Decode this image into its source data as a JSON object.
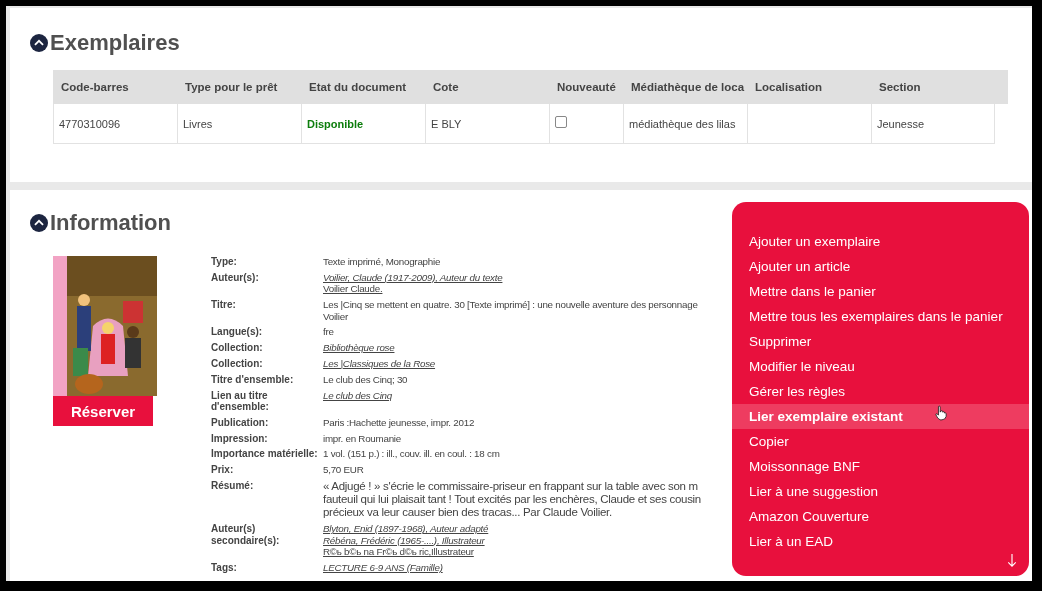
{
  "exemplaires": {
    "title": "Exemplaires",
    "expanded": true,
    "columns": [
      "Code-barres",
      "Type pour le prêt",
      "Etat du document",
      "Cote",
      "Nouveauté",
      "Médiathèque de loca",
      "Localisation",
      "Section"
    ],
    "rows": [
      {
        "code_barres": "4770310096",
        "type": "Livres",
        "etat": "Disponible",
        "cote": "E BLY",
        "nouveaute": false,
        "mediatheque": "médiathèque des lilas",
        "localisation": "",
        "section": "Jeunesse"
      }
    ]
  },
  "information": {
    "title": "Information",
    "expanded": true,
    "reserve_button": "Réserver",
    "fields": [
      {
        "label": "Type:",
        "values": [
          {
            "text": "Texte imprimé, Monographie",
            "kind": "plain"
          }
        ]
      },
      {
        "label": "Auteur(s):",
        "values": [
          {
            "text": "Voilier, Claude (1917-2009), Auteur du texte",
            "kind": "link"
          },
          {
            "text": "Voilier Claude.",
            "kind": "underlined"
          }
        ]
      },
      {
        "label": "Titre:",
        "values": [
          {
            "text": "Les |Cinq se mettent en quatre. 30 [Texte imprimé] : une nouvelle aventure des personnage",
            "kind": "plain"
          },
          {
            "text": "Voilier",
            "kind": "plain"
          }
        ]
      },
      {
        "label": "Langue(s):",
        "values": [
          {
            "text": "fre",
            "kind": "plain"
          }
        ]
      },
      {
        "label": "Collection:",
        "values": [
          {
            "text": "Bibliothèque rose",
            "kind": "link"
          }
        ]
      },
      {
        "label": "Collection:",
        "values": [
          {
            "text": "Les |Classiques de la Rose",
            "kind": "link"
          }
        ]
      },
      {
        "label": "Titre d'ensemble:",
        "values": [
          {
            "text": "Le club des Cinq; 30",
            "kind": "plain"
          }
        ]
      },
      {
        "label": "Lien au titre d'ensemble:",
        "values": [
          {
            "text": "Le club des Cinq",
            "kind": "link"
          }
        ]
      },
      {
        "label": "Publication:",
        "values": [
          {
            "text": "Paris :Hachette jeunesse, impr. 2012",
            "kind": "plain"
          }
        ]
      },
      {
        "label": "Impression:",
        "values": [
          {
            "text": "impr. en Roumanie",
            "kind": "plain"
          }
        ]
      },
      {
        "label": "Importance matérielle:",
        "values": [
          {
            "text": "1 vol. (151 p.) : ill., couv. ill. en coul. : 18 cm",
            "kind": "plain"
          }
        ]
      },
      {
        "label": "Prix:",
        "values": [
          {
            "text": "5,70 EUR",
            "kind": "plain"
          }
        ]
      },
      {
        "label": "Résumé:",
        "values": [
          {
            "text": "« Adjugé ! » s'écrie le commissaire-priseur en frappant sur la table avec son m",
            "kind": "summary"
          },
          {
            "text": "fauteuil qui lui plaisait tant ! Tout excités par les enchères, Claude et ses cousin",
            "kind": "summary"
          },
          {
            "text": "précieux va leur causer bien des tracas... Par Claude Voilier.",
            "kind": "summary"
          }
        ]
      },
      {
        "label": "Auteur(s) secondaire(s):",
        "values": [
          {
            "text": "Blyton, Enid (1897-1968), Auteur adapté",
            "kind": "link"
          },
          {
            "text": "Rébéna, Frédéric (1965-....), Illustrateur",
            "kind": "link"
          },
          {
            "text": "R©ь b©ь na Fr©ь d©ь ric,Illustrateur",
            "kind": "underlined"
          }
        ]
      },
      {
        "label": "Tags:",
        "values": [
          {
            "text": "LECTURE 6-9 ANS (Famille)",
            "kind": "link"
          }
        ]
      }
    ]
  },
  "menu": {
    "items": [
      {
        "label": "Ajouter un exemplaire",
        "selected": false
      },
      {
        "label": "Ajouter un article",
        "selected": false
      },
      {
        "label": "Mettre dans le panier",
        "selected": false
      },
      {
        "label": "Mettre tous les exemplaires dans le panier",
        "selected": false
      },
      {
        "label": "Supprimer",
        "selected": false
      },
      {
        "label": "Modifier le niveau",
        "selected": false
      },
      {
        "label": "Gérer les règles",
        "selected": false
      },
      {
        "label": "Lier exemplaire existant",
        "selected": true
      },
      {
        "label": "Copier",
        "selected": false
      },
      {
        "label": "Moissonnage BNF",
        "selected": false
      },
      {
        "label": "Lier à une suggestion",
        "selected": false
      },
      {
        "label": "Amazon Couverture",
        "selected": false
      },
      {
        "label": "Lier à un EAD",
        "selected": false
      }
    ]
  }
}
